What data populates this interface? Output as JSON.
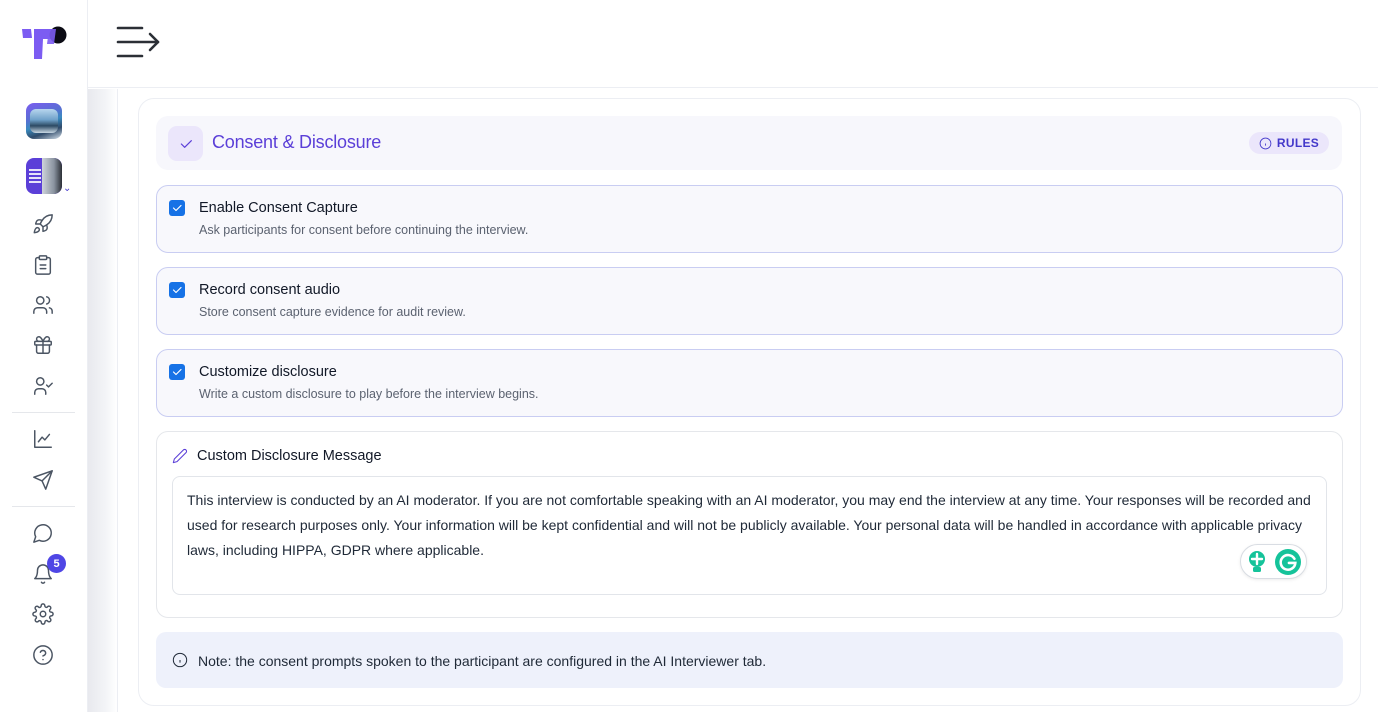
{
  "sidebar": {
    "notification_count": "5"
  },
  "section": {
    "title": "Consent & Disclosure",
    "rules_label": "RULES"
  },
  "options": [
    {
      "title": "Enable Consent Capture",
      "description": "Ask participants for consent before continuing the interview.",
      "checked": true
    },
    {
      "title": "Record consent audio",
      "description": "Store consent capture evidence for audit review.",
      "checked": true
    },
    {
      "title": "Customize disclosure",
      "description": "Write a custom disclosure to play before the interview begins.",
      "checked": true
    }
  ],
  "disclosure": {
    "label": "Custom Disclosure Message",
    "message": "This interview is conducted by an AI moderator. If you are not comfortable speaking with an AI moderator, you may end the interview at any time. Your responses will be recorded and used for research purposes only. Your information will be kept confidential and will not be publicly available. Your personal data will be handled in accordance with applicable privacy laws, including HIPPA, GDPR where applicable."
  },
  "note": {
    "text": "Note: the consent prompts spoken to the participant are configured in the AI Interviewer tab."
  },
  "colors": {
    "accent": "#5b3fd8",
    "checkbox": "#1672e6",
    "badge": "#4f46e5"
  },
  "icons": {
    "menu_toggle": "menu-arrow-icon",
    "nav": [
      "rocket-icon",
      "clipboard-icon",
      "users-icon",
      "gift-icon",
      "user-check-icon",
      "chart-line-icon",
      "send-icon",
      "chat-icon",
      "bell-icon",
      "gear-icon",
      "help-icon"
    ]
  }
}
